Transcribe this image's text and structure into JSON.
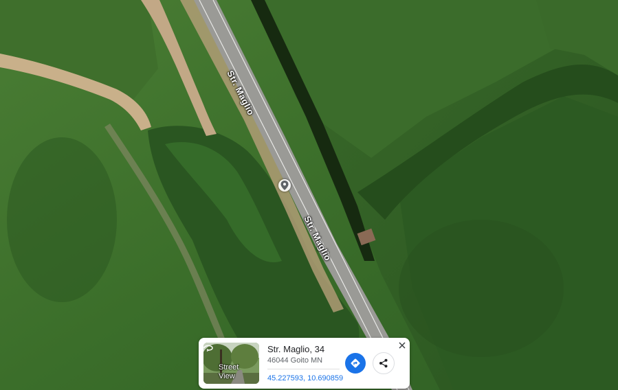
{
  "map": {
    "road_labels": [
      "Str. Maglio",
      "Str. Maglio"
    ],
    "marker_icon": "location-pin-icon",
    "colors": {
      "field_dark": "#2d5a20",
      "field_mid": "#3b6e2a",
      "field_light": "#4a7d34",
      "tree_cover": "#2e5a24",
      "road": "#9a9a96",
      "dirt_track": "#c9b08a"
    }
  },
  "info_card": {
    "street_view_label_line1": "Street",
    "street_view_label_line2": "View",
    "title": "Str. Maglio, 34",
    "subtitle": "46044 Goito MN",
    "coordinates": "45.227593, 10.690859",
    "icons": {
      "close": "close-icon",
      "directions": "directions-icon",
      "share": "share-icon",
      "street_view": "street-view-icon"
    },
    "colors": {
      "accent": "#1a73e8"
    }
  }
}
